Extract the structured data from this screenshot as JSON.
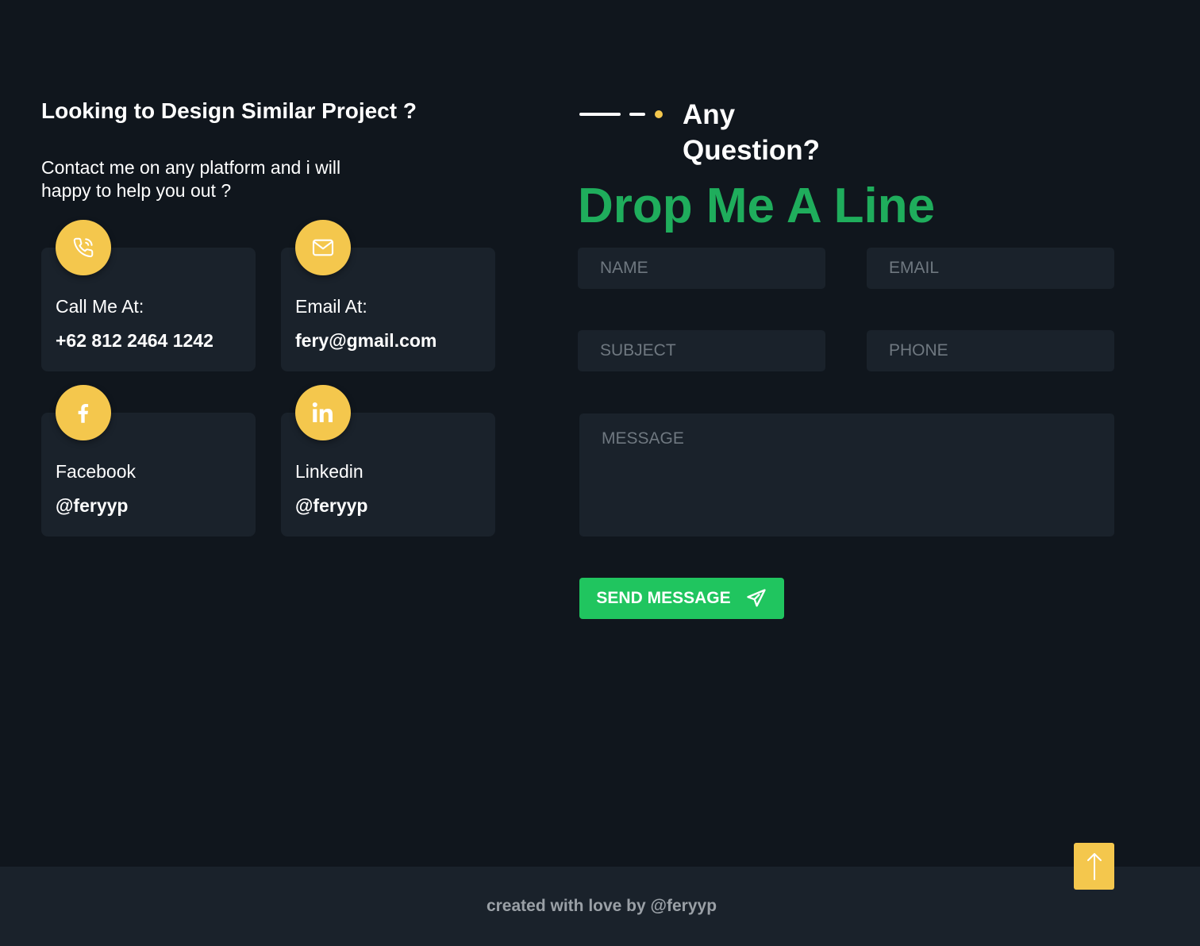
{
  "contact": {
    "title": "Looking to Design Similar Project ?",
    "description": "Contact me on any platform and i will happy to help you out ?",
    "cards": [
      {
        "icon": "phone-icon",
        "label": "Call Me At:",
        "value": "+62 812 2464 1242"
      },
      {
        "icon": "envelope-icon",
        "label": "Email At:",
        "value": "fery@gmail.com"
      },
      {
        "icon": "facebook-icon",
        "label": "Facebook",
        "value": "@feryyp"
      },
      {
        "icon": "linkedin-icon",
        "label": "Linkedin",
        "value": "@feryyp"
      }
    ]
  },
  "form": {
    "subtitle": "Any Question?",
    "title": "Drop Me A Line",
    "fields": {
      "name": {
        "placeholder": "NAME",
        "value": ""
      },
      "email": {
        "placeholder": "EMAIL",
        "value": ""
      },
      "subject": {
        "placeholder": "SUBJECT",
        "value": ""
      },
      "phone": {
        "placeholder": "PHONE",
        "value": ""
      },
      "message": {
        "placeholder": "MESSAGE",
        "value": ""
      }
    },
    "send_label": "SEND MESSAGE",
    "send_icon": "paper-plane-icon"
  },
  "scroll_top": {
    "icon": "arrow-up-icon"
  },
  "footer": {
    "text": "created with love by @feryyp"
  },
  "colors": {
    "background": "#10161d",
    "card": "#1a222b",
    "accent_yellow": "#f4c74d",
    "accent_green": "#1fad5c",
    "button_green": "#20c55f",
    "footer_text": "#9aa0a6"
  }
}
